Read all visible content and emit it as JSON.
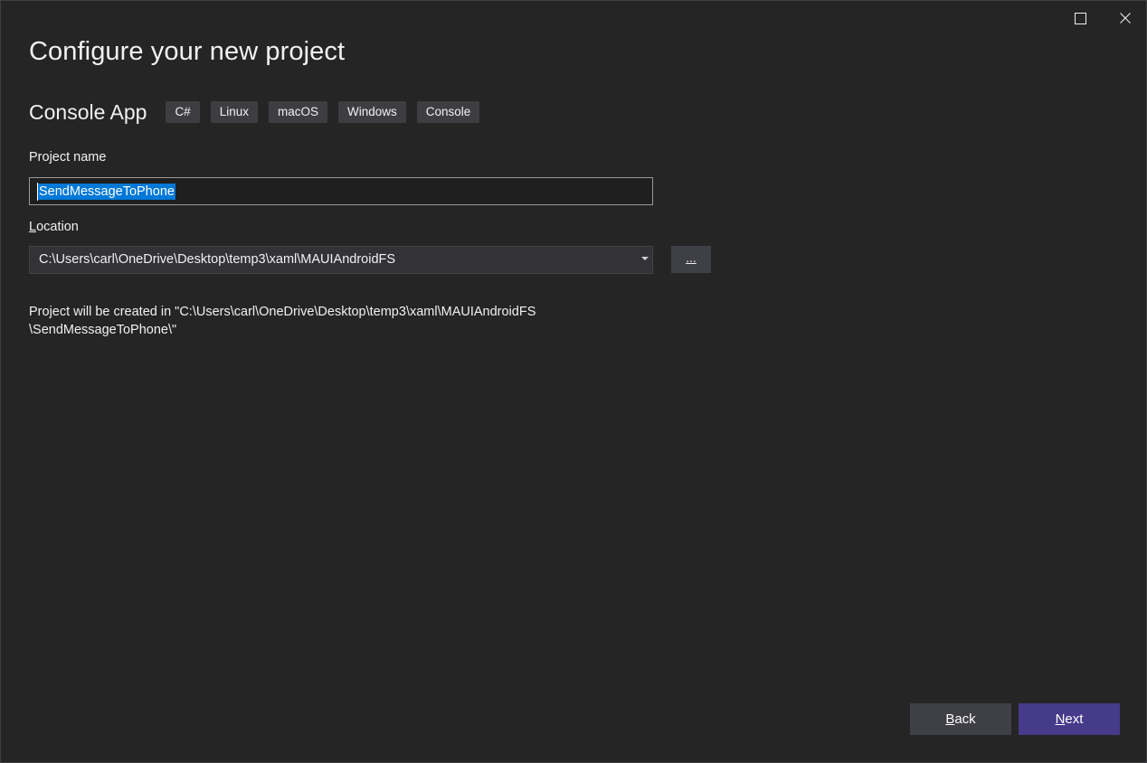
{
  "window": {
    "maximize_icon": "maximize-icon",
    "close_icon": "close-icon"
  },
  "page": {
    "title": "Configure your new project"
  },
  "template": {
    "name": "Console App",
    "tags": [
      "C#",
      "Linux",
      "macOS",
      "Windows",
      "Console"
    ]
  },
  "project_name": {
    "label": "Project name",
    "value": "SendMessageToPhone"
  },
  "location": {
    "label_access_key": "L",
    "label_rest": "ocation",
    "value": "C:\\Users\\carl\\OneDrive\\Desktop\\temp3\\xaml\\MAUIAndroidFS",
    "browse_label": "..."
  },
  "info": {
    "line1": "Project will be created in \"C:\\Users\\carl\\OneDrive\\Desktop\\temp3\\xaml\\MAUIAndroidFS",
    "line2": "\\SendMessageToPhone\\\""
  },
  "footer": {
    "back_access_key": "B",
    "back_rest": "ack",
    "next_access_key": "N",
    "next_rest": "ext"
  },
  "colors": {
    "background": "#252526",
    "accent_selection": "#0078d7",
    "next_button": "#463a8a",
    "secondary_button": "#3f3f46"
  }
}
